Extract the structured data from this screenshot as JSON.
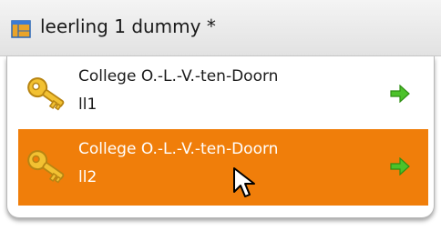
{
  "window": {
    "title": "leerling 1 dummy *",
    "icon": "table-window-icon"
  },
  "dropdown": {
    "items": [
      {
        "line1": "College O.-L.-V.-ten-Doorn",
        "line2": "ll1",
        "icon": "key-icon",
        "action_icon": "green-arrow-right-icon",
        "state": "normal"
      },
      {
        "line1": "College O.-L.-V.-ten-Doorn",
        "line2": "ll2",
        "icon": "key-icon",
        "action_icon": "green-arrow-right-icon",
        "state": "hover"
      }
    ]
  },
  "colors": {
    "highlight": "#f07e0a",
    "arrow": "#4cc22a",
    "key": "#f2c132"
  }
}
